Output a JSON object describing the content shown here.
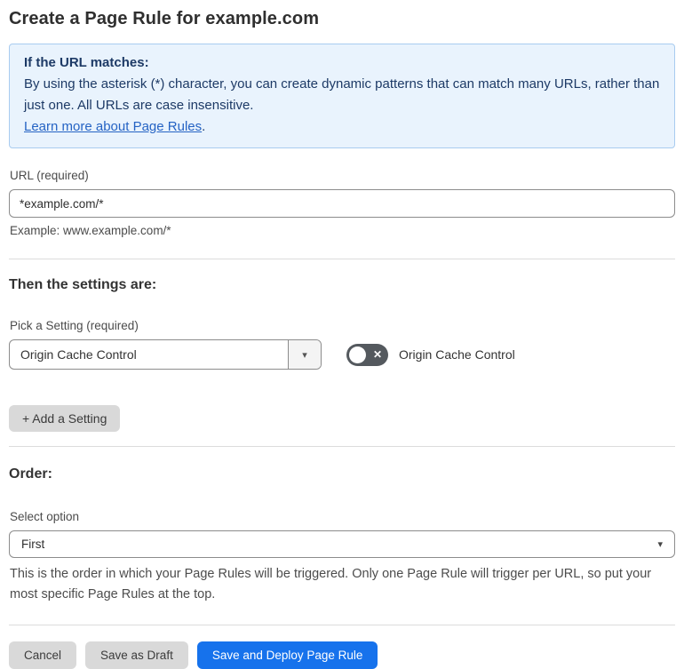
{
  "page": {
    "title": "Create a Page Rule for example.com"
  },
  "info_box": {
    "heading": "If the URL matches:",
    "body": "By using the asterisk (*) character, you can create dynamic patterns that can match many URLs, rather than just one. All URLs are case insensitive.",
    "link_label": "Learn more about Page Rules",
    "link_suffix": "."
  },
  "url_field": {
    "label": "URL (required)",
    "value": "*example.com/*",
    "example": "Example: www.example.com/*"
  },
  "settings_section": {
    "heading": "Then the settings are:",
    "picker_label": "Pick a Setting (required)",
    "picker_value": "Origin Cache Control",
    "toggle_label": "Origin Cache Control",
    "toggle_state": "off",
    "add_setting_label": "+ Add a Setting"
  },
  "order_section": {
    "heading": "Order:",
    "select_label": "Select option",
    "select_value": "First",
    "help_text": "This is the order in which your Page Rules will be triggered. Only one Page Rule will trigger per URL, so put your most specific Page Rules at the top."
  },
  "footer": {
    "cancel_label": "Cancel",
    "save_draft_label": "Save as Draft",
    "save_deploy_label": "Save and Deploy Page Rule"
  },
  "icons": {
    "caret_down": "▾",
    "toggle_x": "✕"
  },
  "colors": {
    "info_bg": "#e9f3fd",
    "info_border": "#a9ccf0",
    "info_text": "#1d3a66",
    "link": "#2563c4",
    "primary_button": "#1672ec",
    "secondary_button": "#d9d9d9",
    "toggle_off_bg": "#54595e"
  }
}
